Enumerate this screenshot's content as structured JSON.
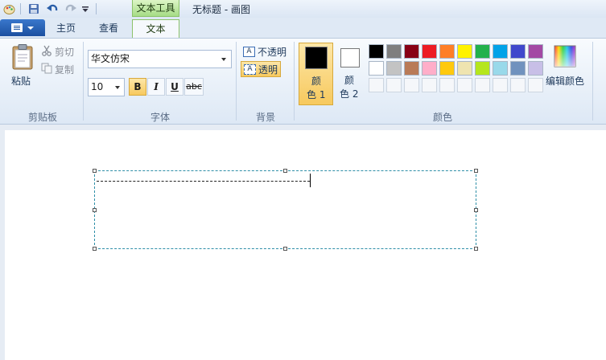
{
  "window": {
    "title": "无标题 - 画图",
    "context_tab_header": "文本工具"
  },
  "tabs": [
    {
      "label": "主页"
    },
    {
      "label": "查看"
    },
    {
      "label": "文本",
      "active": true
    }
  ],
  "clipboard": {
    "paste": "粘贴",
    "cut": "剪切",
    "copy": "复制",
    "group": "剪贴板"
  },
  "font": {
    "family": "华文仿宋",
    "size": "10",
    "bold": "B",
    "italic": "I",
    "underline": "U",
    "strikethrough": "abc",
    "bold_active": true,
    "group": "字体"
  },
  "background": {
    "opaque": "不透明",
    "transparent": "透明",
    "selected": "transparent",
    "group": "背景"
  },
  "colors": {
    "color1_label": "颜\n色 1",
    "color1_line1": "颜",
    "color1_line2": "色 1",
    "color2_line1": "颜",
    "color2_line2": "色 2",
    "color1": "#000000",
    "color2": "#ffffff",
    "edit": "编辑颜色",
    "group": "颜色",
    "palette_row1": [
      "#000000",
      "#7f7f7f",
      "#880015",
      "#ed1c24",
      "#ff7f27",
      "#fff200",
      "#22b14c",
      "#00a2e8",
      "#3f48cc",
      "#a349a4"
    ],
    "palette_row2": [
      "#ffffff",
      "#c3c3c3",
      "#b97a57",
      "#ffaec9",
      "#ffc90e",
      "#efe4b0",
      "#b5e61d",
      "#99d9ea",
      "#7092be",
      "#c8bfe7"
    ],
    "palette_row3_empty": 10
  }
}
